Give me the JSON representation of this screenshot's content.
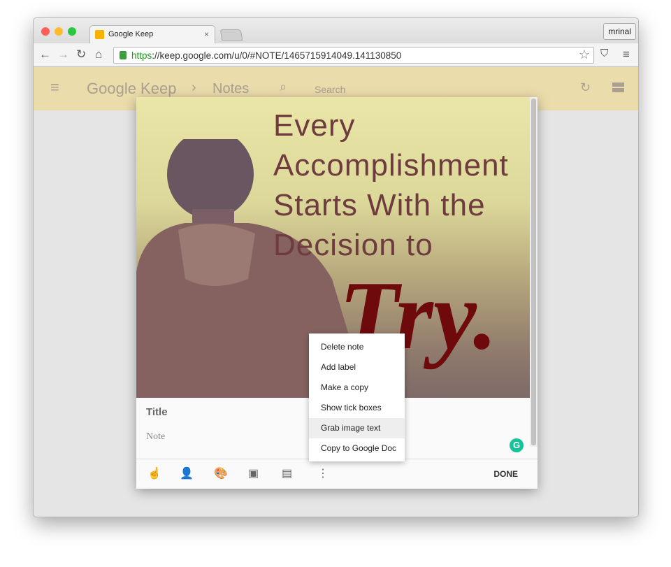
{
  "browser": {
    "tab_title": "Google Keep",
    "tab_close": "×",
    "user": "mrinal",
    "url_scheme": "https",
    "url_rest": "://keep.google.com/u/0/#NOTE/1465715914049.141130850"
  },
  "keep": {
    "app_name": "Google Keep",
    "separator": "›",
    "section": "Notes",
    "search_placeholder": "Search"
  },
  "note": {
    "image_text": [
      "Every",
      "Accomplishment",
      "Starts With the",
      "Decision to"
    ],
    "image_script": "Try.",
    "title_placeholder": "Title",
    "note_placeholder": "Note",
    "done_label": "DONE"
  },
  "menu": {
    "items": [
      "Delete note",
      "Add label",
      "Make a copy",
      "Show tick boxes",
      "Grab image text",
      "Copy to Google Doc"
    ],
    "highlighted": "Grab image text"
  },
  "colors": {
    "header": "#ebdcab",
    "grammarly": "#15c39a"
  }
}
